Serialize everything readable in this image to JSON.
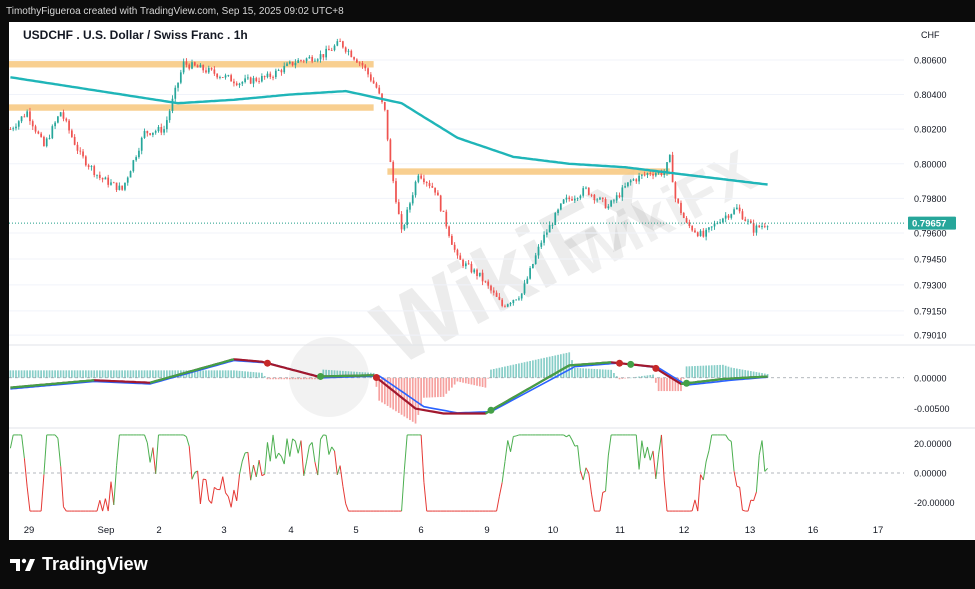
{
  "header": {
    "credit": "TimothyFigueroa created with TradingView.com, Sep 15, 2025 09:02 UTC+8"
  },
  "chart": {
    "title": "USDCHF . U.S. Dollar / Swiss Franc . 1h",
    "currency": "CHF",
    "current_price_label": "0.79657"
  },
  "watermark": {
    "text": "WikiFX"
  },
  "footer": {
    "brand": "TradingView"
  },
  "chart_data": [
    {
      "type": "candlestick",
      "title": "USDCHF . U.S. Dollar / Swiss Franc . 1h",
      "ylabel": "CHF",
      "ylim": [
        0.7897,
        0.8075
      ],
      "y_ticks": [
        "0.80600",
        "0.80400",
        "0.80200",
        "0.80000",
        "0.79800",
        "0.79600",
        "0.79450",
        "0.79300",
        "0.79150",
        "0.79010"
      ],
      "current_price": 0.79657,
      "x_ticks": [
        "29",
        "Sep",
        "2",
        "3",
        "4",
        "5",
        "6",
        "9",
        "10",
        "11",
        "12",
        "13",
        "16",
        "17"
      ],
      "close_path": [
        [
          0,
          0.802
        ],
        [
          6,
          0.803
        ],
        [
          12,
          0.801
        ],
        [
          18,
          0.803
        ],
        [
          25,
          0.8005
        ],
        [
          32,
          0.7992
        ],
        [
          40,
          0.7985
        ],
        [
          48,
          0.8018
        ],
        [
          55,
          0.802
        ],
        [
          62,
          0.8058
        ],
        [
          72,
          0.8053
        ],
        [
          82,
          0.8047
        ],
        [
          92,
          0.805
        ],
        [
          102,
          0.8059
        ],
        [
          112,
          0.8063
        ],
        [
          118,
          0.807
        ],
        [
          126,
          0.8057
        ],
        [
          131,
          0.8044
        ],
        [
          134,
          0.803
        ],
        [
          136,
          0.8
        ],
        [
          140,
          0.796
        ],
        [
          146,
          0.7995
        ],
        [
          152,
          0.7985
        ],
        [
          160,
          0.7945
        ],
        [
          168,
          0.7935
        ],
        [
          176,
          0.7918
        ],
        [
          183,
          0.7925
        ],
        [
          190,
          0.7955
        ],
        [
          198,
          0.7978
        ],
        [
          206,
          0.7985
        ],
        [
          214,
          0.7975
        ],
        [
          222,
          0.799
        ],
        [
          229,
          0.7995
        ],
        [
          234,
          0.7995
        ],
        [
          236,
          0.8003
        ],
        [
          238,
          0.798
        ],
        [
          242,
          0.7965
        ],
        [
          248,
          0.7958
        ],
        [
          254,
          0.7968
        ],
        [
          260,
          0.7974
        ],
        [
          266,
          0.7962
        ],
        [
          271,
          0.7966
        ]
      ],
      "ma_path": [
        [
          0,
          0.805
        ],
        [
          20,
          0.8045
        ],
        [
          40,
          0.804
        ],
        [
          60,
          0.8035
        ],
        [
          80,
          0.8037
        ],
        [
          100,
          0.804
        ],
        [
          120,
          0.8042
        ],
        [
          140,
          0.8035
        ],
        [
          160,
          0.8015
        ],
        [
          180,
          0.8004
        ],
        [
          200,
          0.8
        ],
        [
          220,
          0.7998
        ],
        [
          240,
          0.7994
        ],
        [
          271,
          0.7988
        ]
      ],
      "resistance_zones": [
        {
          "price": 0.80575,
          "from_bar": 0,
          "to_bar": 130
        },
        {
          "price": 0.80325,
          "from_bar": 0,
          "to_bar": 130
        },
        {
          "price": 0.79955,
          "from_bar": 136,
          "to_bar": 236
        }
      ]
    },
    {
      "type": "line",
      "title": "",
      "y_ticks": [
        "0.00000",
        "-0.00500"
      ],
      "ylim": [
        -0.0075,
        0.0045
      ],
      "series": [
        {
          "values": [
            [
              0,
              -0.0016
            ],
            [
              30,
              -0.0004
            ],
            [
              50,
              -0.0008
            ],
            [
              80,
              0.003
            ],
            [
              90,
              0.0026
            ],
            [
              110,
              0.0002
            ],
            [
              130,
              0.0004
            ],
            [
              145,
              -0.005
            ],
            [
              155,
              -0.0058
            ],
            [
              170,
              -0.0058
            ],
            [
              200,
              0.002
            ],
            [
              215,
              0.0025
            ],
            [
              230,
              0.0018
            ],
            [
              240,
              -0.001
            ],
            [
              255,
              -0.0002
            ],
            [
              271,
              0.0002
            ]
          ]
        },
        {
          "values": [
            [
              0,
              -0.0018
            ],
            [
              30,
              -0.0006
            ],
            [
              50,
              -0.001
            ],
            [
              80,
              0.0028
            ],
            [
              92,
              0.0024
            ],
            [
              112,
              0.0
            ],
            [
              132,
              0.0003
            ],
            [
              148,
              -0.0047
            ],
            [
              160,
              -0.0057
            ],
            [
              172,
              -0.0055
            ],
            [
              202,
              0.0018
            ],
            [
              218,
              0.0024
            ],
            [
              232,
              0.0016
            ],
            [
              242,
              -0.0012
            ],
            [
              258,
              -0.0004
            ],
            [
              271,
              0.0001
            ]
          ]
        },
        {
          "values": [
            [
              0,
              -0.0015
            ],
            [
              30,
              -0.0005
            ],
            [
              50,
              -0.0007
            ],
            [
              80,
              0.0031
            ],
            [
              90,
              0.0025
            ],
            [
              110,
              0.0001
            ],
            [
              130,
              0.0004
            ],
            [
              145,
              -0.0049
            ],
            [
              155,
              -0.0057
            ],
            [
              170,
              -0.0056
            ],
            [
              200,
              0.0021
            ],
            [
              215,
              0.0026
            ],
            [
              230,
              0.0017
            ],
            [
              240,
              -0.0011
            ],
            [
              255,
              -0.0003
            ],
            [
              271,
              0.0002
            ]
          ]
        }
      ],
      "histogram_range": [
        -0.0015,
        0.0015
      ]
    },
    {
      "type": "line",
      "title": "",
      "y_ticks": [
        "20.00000",
        "0.00000",
        "-20.00000"
      ],
      "ylim": [
        -28,
        28
      ],
      "threshold": 0
    }
  ]
}
